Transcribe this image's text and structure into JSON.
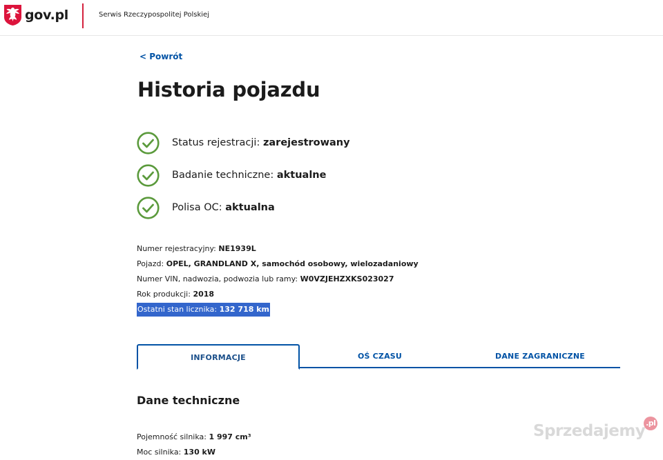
{
  "header": {
    "logo_text": "gov.pl",
    "service_name": "Serwis Rzeczypospolitej Polskiej"
  },
  "nav": {
    "back_label": "< Powrót"
  },
  "page": {
    "title": "Historia pojazdu"
  },
  "status": [
    {
      "label": "Status rejestracji: ",
      "value": "zarejestrowany",
      "icon": "check-circle-icon"
    },
    {
      "label": "Badanie techniczne: ",
      "value": "aktualne",
      "icon": "check-circle-icon"
    },
    {
      "label": "Polisa OC: ",
      "value": "aktualna",
      "icon": "check-circle-icon"
    }
  ],
  "vehicle": {
    "registration_label": "Numer rejestracyjny: ",
    "registration_value": "NE1939L",
    "vehicle_label": "Pojazd: ",
    "vehicle_value": "OPEL, GRANDLAND X, samochód osobowy, wielozadaniowy",
    "vin_label": "Numer VIN, nadwozia, podwozia lub ramy: ",
    "vin_value": "W0VZJEHZXKS023027",
    "year_label": "Rok produkcji: ",
    "year_value": "2018",
    "odometer_label": "Ostatni stan licznika: ",
    "odometer_value": "132 718 km"
  },
  "tabs": [
    {
      "label": "INFORMACJE",
      "active": true
    },
    {
      "label": "OŚ CZASU",
      "active": false
    },
    {
      "label": "DANE ZAGRANICZNE",
      "active": false
    }
  ],
  "technical": {
    "title": "Dane techniczne",
    "engine_capacity_label": "Pojemność silnika: ",
    "engine_capacity_value": "1 997 cm³",
    "engine_power_label": "Moc silnika: ",
    "engine_power_value": "130 kW"
  },
  "watermark": {
    "text": "Sprzedajemy",
    "badge": ".pl"
  },
  "colors": {
    "accent_blue": "#0052a5",
    "check_green": "#5b9a3c",
    "brand_red": "#d4213d",
    "selection": "#3366cc"
  }
}
